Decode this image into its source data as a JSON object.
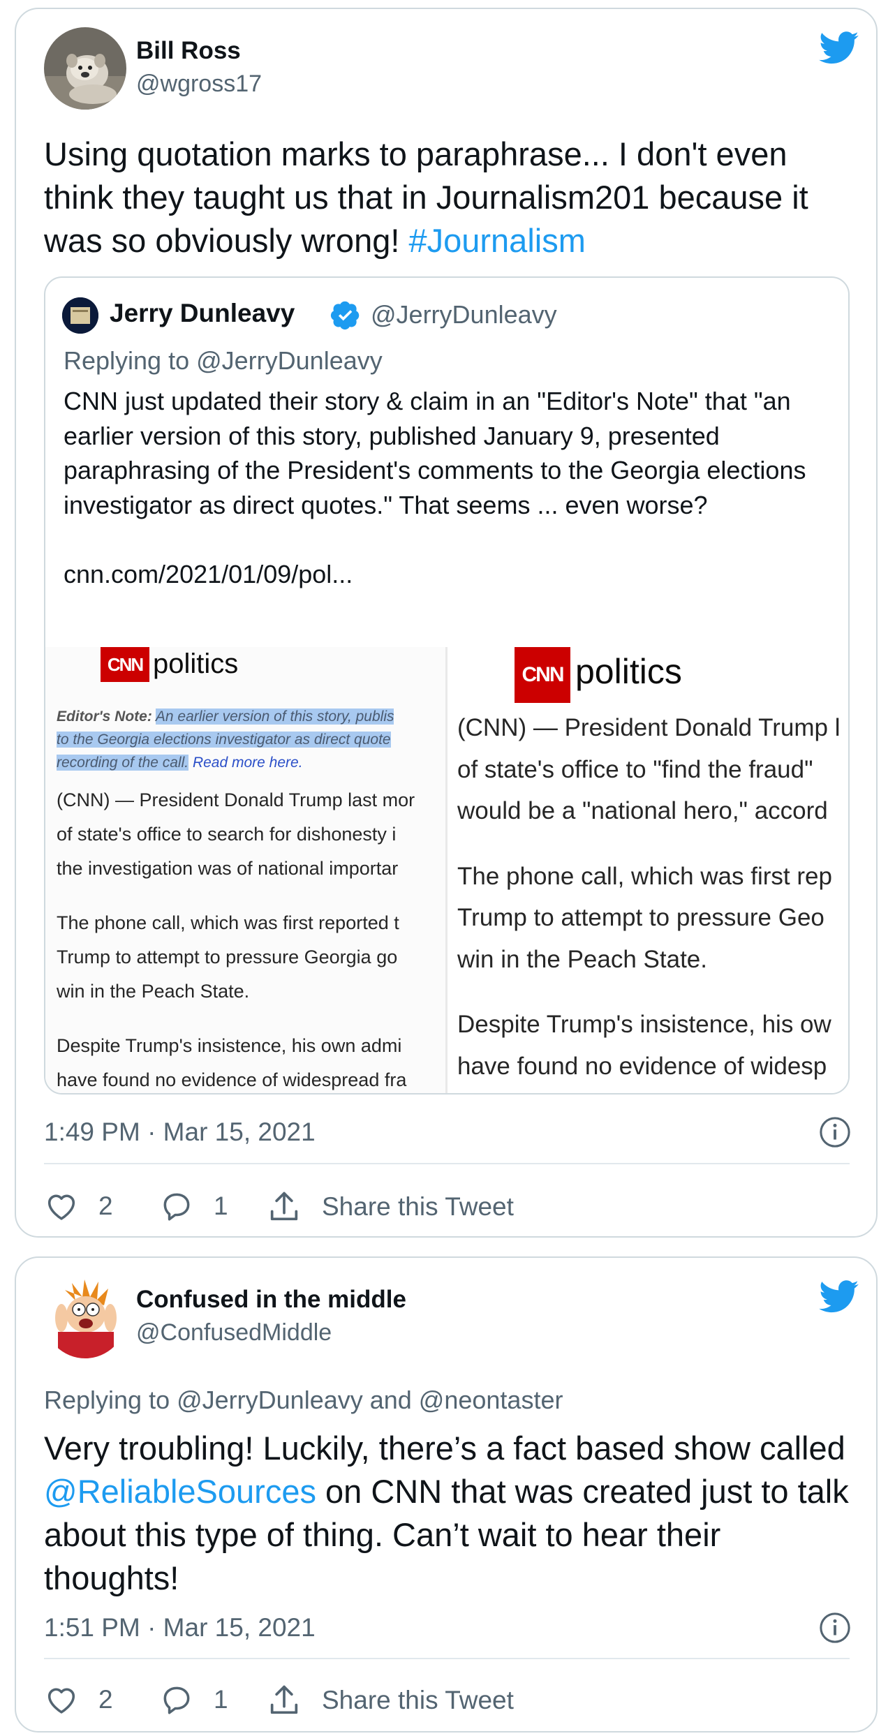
{
  "tweets": [
    {
      "name": "Bill Ross",
      "handle": "@wgross17",
      "text_before": "Using quotation marks to paraphrase... I don't even think they taught us that in Journalism201 because it was so obviously wrong! ",
      "hashtag": "#Journalism",
      "quoted": {
        "name": "Jerry Dunleavy",
        "handle": "@JerryDunleavy",
        "replying_to": "Replying to @JerryDunleavy",
        "text": "CNN just updated their story & claim in an \"Editor's Note\" that \"an earlier version of this story, published January 9, presented paraphrasing of the President's comments to the Georgia elections investigator as direct quotes.\" That seems ... even worse?\n\ncnn.com/2021/01/09/pol...",
        "left_image": {
          "logo_text": "CNN",
          "section": "politics",
          "editor_note_label": "Editor's Note:",
          "editor_note_lines": [
            "An earlier version of this story, publis",
            "to the Georgia elections investigator as direct quote",
            "recording of the call."
          ],
          "read_more": "Read more here.",
          "paragraphs": [
            [
              "(CNN) — President Donald Trump last mor",
              "of state's office to search for dishonesty i",
              "the investigation was of national importar"
            ],
            [
              "The phone call, which was first reported t",
              "Trump to attempt to pressure Georgia go",
              "win in the Peach State."
            ],
            [
              "Despite Trump's insistence, his own admi",
              "have found no evidence of widespread fra"
            ]
          ]
        },
        "right_image": {
          "logo_text": "CNN",
          "section": "politics",
          "paragraphs": [
            [
              "(CNN) — President Donald Trump l",
              "of state's office to \"find the fraud\"",
              "would be a \"national hero,\" accord"
            ],
            [
              "The phone call, which was first rep",
              "Trump to attempt to pressure Geo",
              "win in the Peach State."
            ],
            [
              "Despite Trump's insistence, his ow",
              "have found no evidence of widesp"
            ]
          ]
        }
      },
      "timestamp": "1:49 PM · Mar 15, 2021",
      "likes": "2",
      "replies": "1",
      "share_label": "Share this Tweet"
    },
    {
      "name": "Confused in the middle",
      "handle": "@ConfusedMiddle",
      "replying_to": "Replying to @JerryDunleavy and @neontaster",
      "text_before": "Very troubling!  Luckily, there’s a fact based  show called ",
      "mention": "@ReliableSources",
      "text_after": " on CNN that was created just to talk about this type of thing. Can’t wait to hear their thoughts!",
      "timestamp": "1:51 PM · Mar 15, 2021",
      "likes": "2",
      "replies": "1",
      "share_label": "Share this Tweet"
    }
  ],
  "colors": {
    "brand_blue": "#1d9bf0",
    "secondary_text": "#536471",
    "cnn_red": "#cc0000",
    "border": "#cfd9de"
  },
  "icons": [
    "twitter-bird-icon",
    "verified-badge-icon",
    "info-icon",
    "heart-icon",
    "reply-icon",
    "share-icon"
  ]
}
